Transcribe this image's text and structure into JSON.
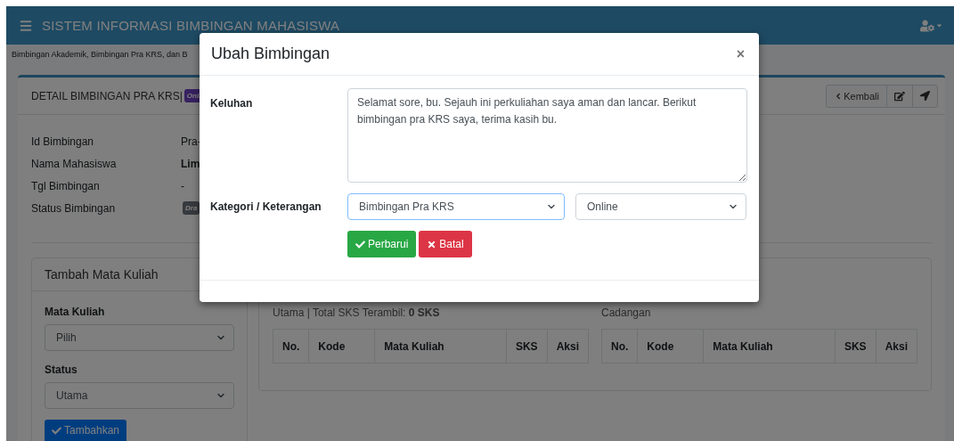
{
  "navbar": {
    "title": "SISTEM INFORMASI BIMBINGAN MAHASISWA"
  },
  "breadcrumb": "Bimbingan Akademik, Bimbingan Pra KRS, dan B",
  "detail_card": {
    "title": "DETAIL BIMBINGAN PRA KRS|",
    "badge": "Onli",
    "header_buttons": [
      {
        "kind": "back",
        "label": "Kembali"
      },
      {
        "kind": "edit"
      },
      {
        "kind": "send"
      }
    ],
    "fields": [
      {
        "label": "Id Bimbingan",
        "value": "Pra-",
        "kind": "text"
      },
      {
        "label": "Nama Mahasiswa",
        "value": "Lim",
        "kind": "bold"
      },
      {
        "label": "Tgl Bimbingan",
        "value": "-",
        "kind": "text"
      },
      {
        "label": "Status Bimbingan",
        "value": "Dra",
        "kind": "badge"
      }
    ]
  },
  "add_course": {
    "title": "Tambah Mata Kuliah",
    "fields": [
      {
        "label": "Mata Kuliah",
        "value": "Pilih"
      },
      {
        "label": "Status",
        "value": "Utama"
      }
    ],
    "button": "Tambahkan"
  },
  "main_list": {
    "summary": "Utama | Total SKS Terambil: **0 SKS**",
    "columns": [
      "No.",
      "Kode",
      "Mata Kuliah",
      "SKS",
      "Aksi"
    ]
  },
  "reserve_list": {
    "title": "Cadangan",
    "columns": [
      "No.",
      "Kode",
      "Mata Kuliah",
      "SKS",
      "Aksi"
    ]
  },
  "modal": {
    "title": "Ubah Bimbingan",
    "close": "×",
    "complaint": {
      "label": "Keluhan",
      "value": "Selamat sore, bu. Sejauh ini perkuliahan saya aman dan lancar. Berikut bimbingan pra KRS saya, terima kasih bu."
    },
    "category": {
      "label": "Kategori / Keterangan",
      "selects": [
        {
          "value": "Bimbingan Pra KRS",
          "focused": true
        },
        {
          "value": "Online",
          "focused": false
        }
      ]
    },
    "buttons": [
      {
        "label": "Perbarui",
        "kind": "success"
      },
      {
        "label": "Batal",
        "kind": "danger"
      }
    ]
  }
}
